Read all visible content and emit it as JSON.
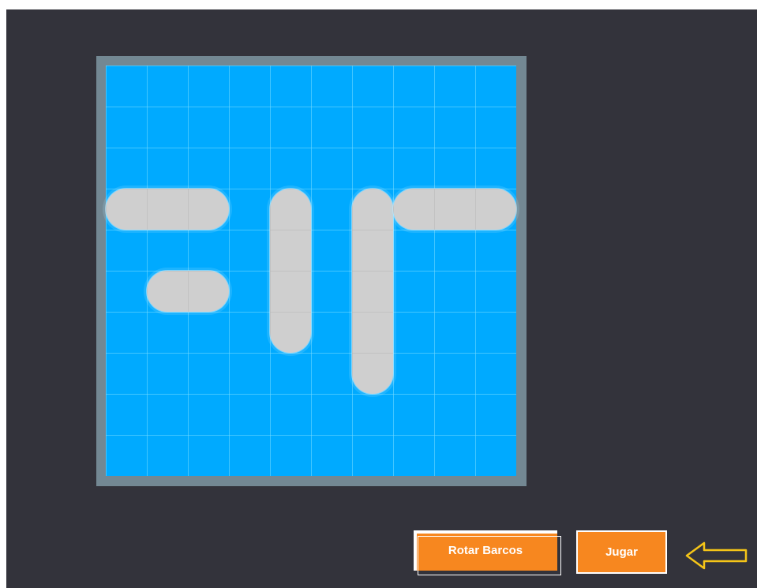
{
  "board": {
    "rows": 10,
    "cols": 10,
    "water_color": "#00aaff",
    "frame_color": "#738893"
  },
  "ships": [
    {
      "id": "ship-1",
      "orientation": "horizontal",
      "row": 3,
      "col": 0,
      "length": 3
    },
    {
      "id": "ship-2",
      "orientation": "horizontal",
      "row": 5,
      "col": 1,
      "length": 2
    },
    {
      "id": "ship-3",
      "orientation": "vertical",
      "row": 3,
      "col": 4,
      "length": 4
    },
    {
      "id": "ship-4",
      "orientation": "vertical",
      "row": 3,
      "col": 6,
      "length": 5
    },
    {
      "id": "ship-5",
      "orientation": "horizontal",
      "row": 3,
      "col": 7,
      "length": 3
    }
  ],
  "buttons": {
    "rotate_label": "Rotar Barcos",
    "play_label": "Jugar"
  },
  "hint": {
    "icon": "left-arrow-outline-icon",
    "color": "#f5c518"
  },
  "colors": {
    "background": "#33333b",
    "button": "#f7871f",
    "ship": "#cfcfcf"
  }
}
